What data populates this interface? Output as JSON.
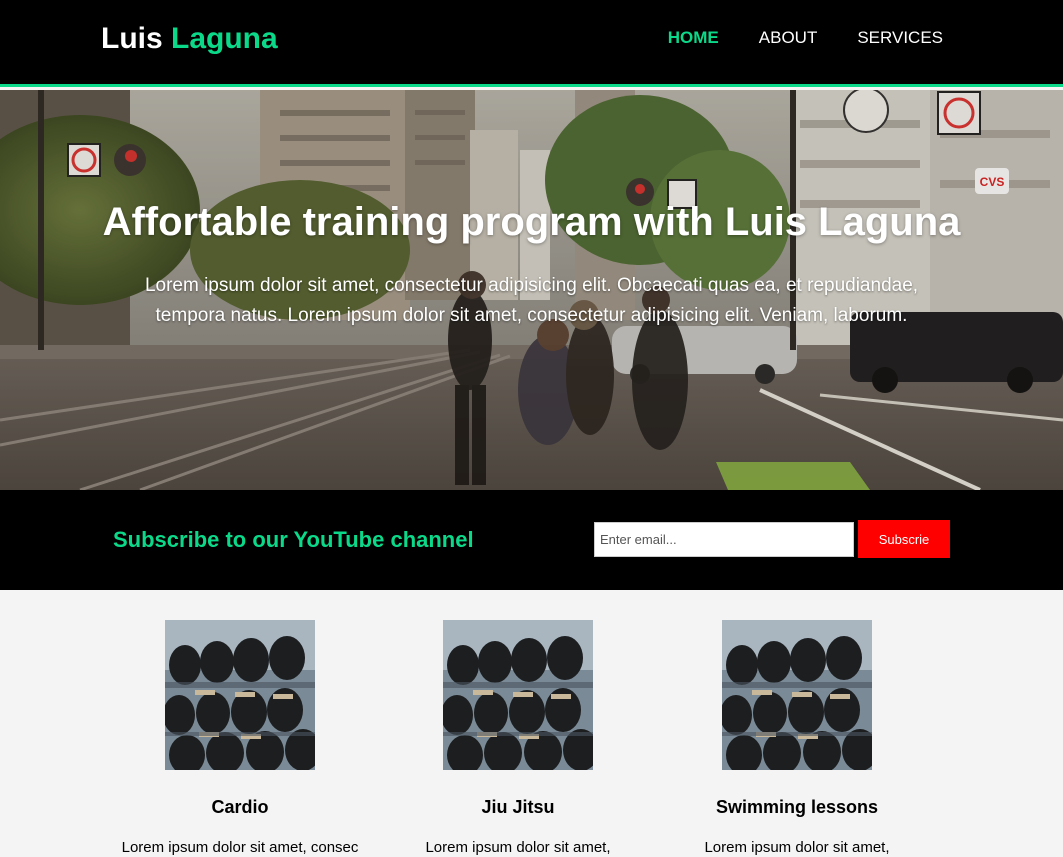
{
  "header": {
    "brand_first": "Luis",
    "brand_second": "Laguna",
    "nav": [
      {
        "label": "HOME",
        "active": true
      },
      {
        "label": "ABOUT",
        "active": false
      },
      {
        "label": "SERVICES",
        "active": false
      }
    ]
  },
  "hero": {
    "title": "Affortable training program with Luis Laguna",
    "text": "Lorem ipsum dolor sit amet, consectetur adipisicing elit. Obcaecati quas ea, et repudiandae, tempora natus. Lorem ipsum dolor sit amet, consectetur adipisicing elit. Veniam, laborum."
  },
  "subscribe": {
    "title": "Subscribe to our YouTube channel",
    "email_placeholder": "Enter email...",
    "button_label": "Subscrie"
  },
  "cards": [
    {
      "title": "Cardio",
      "text": "Lorem ipsum dolor sit amet, consec"
    },
    {
      "title": "Jiu Jitsu",
      "text": "Lorem ipsum dolor sit amet,"
    },
    {
      "title": "Swimming lessons",
      "text": "Lorem ipsum dolor sit amet,"
    }
  ],
  "colors": {
    "accent": "#0bd98a",
    "header_bg": "#000000",
    "subscribe_button": "#ff0000",
    "page_bg": "#f4f4f4"
  }
}
